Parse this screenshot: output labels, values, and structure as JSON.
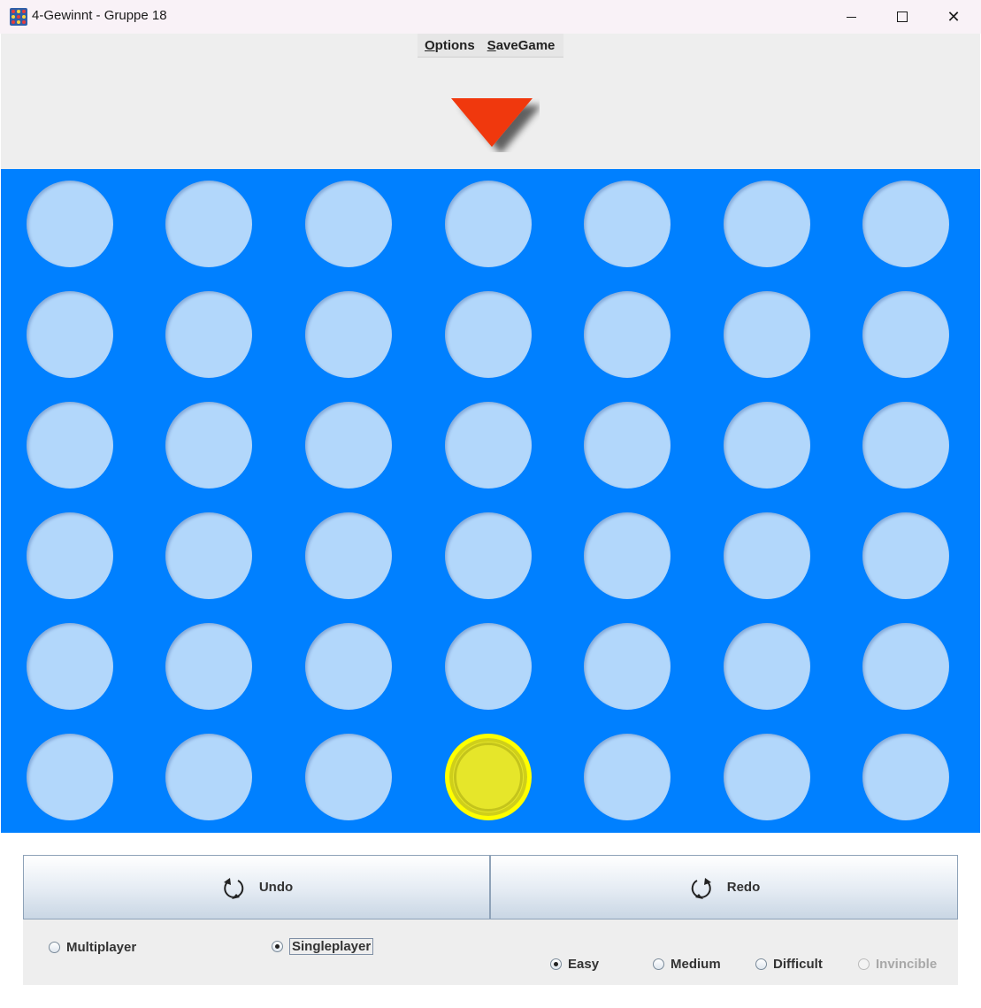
{
  "window": {
    "title": "4-Gewinnt - Gruppe 18",
    "minimize_glyph": "",
    "close_glyph": "✕"
  },
  "menu": {
    "options_mnemonic": "O",
    "options_rest": "ptions",
    "savegame_mnemonic": "S",
    "savegame_rest": "aveGame"
  },
  "colors": {
    "board": "#0080ff",
    "empty_cell": "#b2d7fb",
    "player_yellow": "#e6e62a",
    "drop_arrow": "#f0390f"
  },
  "board": {
    "rows": 6,
    "columns": 7,
    "selected_column": 4,
    "cells": [
      [
        "empty",
        "empty",
        "empty",
        "empty",
        "empty",
        "empty",
        "empty"
      ],
      [
        "empty",
        "empty",
        "empty",
        "empty",
        "empty",
        "empty",
        "empty"
      ],
      [
        "empty",
        "empty",
        "empty",
        "empty",
        "empty",
        "empty",
        "empty"
      ],
      [
        "empty",
        "empty",
        "empty",
        "empty",
        "empty",
        "empty",
        "empty"
      ],
      [
        "empty",
        "empty",
        "empty",
        "empty",
        "empty",
        "empty",
        "empty"
      ],
      [
        "empty",
        "empty",
        "empty",
        "yellow",
        "empty",
        "empty",
        "empty"
      ]
    ]
  },
  "controls": {
    "undo_label": "Undo",
    "redo_label": "Redo",
    "undo_icon": "undo-arrow-icon",
    "redo_icon": "redo-arrow-icon"
  },
  "mode": {
    "multiplayer_label": "Multiplayer",
    "singleplayer_label": "Singleplayer",
    "selected": "Singleplayer"
  },
  "difficulty": {
    "easy_label": "Easy",
    "medium_label": "Medium",
    "difficult_label": "Difficult",
    "invincible_label": "Invincible",
    "selected": "Easy",
    "invincible_enabled": false
  }
}
